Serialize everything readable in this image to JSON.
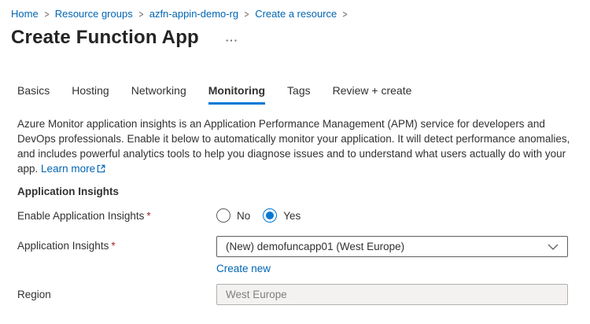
{
  "breadcrumb": {
    "separator": ">",
    "items": [
      "Home",
      "Resource groups",
      "azfn-appin-demo-rg",
      "Create a resource"
    ]
  },
  "header": {
    "title": "Create Function App",
    "more_options": "···"
  },
  "tabs": [
    {
      "label": "Basics",
      "active": false
    },
    {
      "label": "Hosting",
      "active": false
    },
    {
      "label": "Networking",
      "active": false
    },
    {
      "label": "Monitoring",
      "active": true
    },
    {
      "label": "Tags",
      "active": false
    },
    {
      "label": "Review + create",
      "active": false
    }
  ],
  "description": {
    "text": "Azure Monitor application insights is an Application Performance Management (APM) service for developers and DevOps professionals. Enable it below to automatically monitor your application. It will detect performance anomalies, and includes powerful analytics tools to help you diagnose issues and to understand what users actually do with your app.",
    "learn_more_label": "Learn more"
  },
  "section": {
    "heading": "Application Insights"
  },
  "form": {
    "enable_label": "Enable Application Insights",
    "required_marker": "*",
    "options": {
      "no": "No",
      "yes": "Yes"
    },
    "selected_option": "Yes",
    "app_insights_label": "Application Insights",
    "app_insights_value": "(New) demofuncapp01 (West Europe)",
    "create_new_label": "Create new",
    "region_label": "Region",
    "region_value": "West Europe"
  },
  "colors": {
    "link_blue": "#0065b3",
    "accent_blue": "#0078d4",
    "text": "#323130",
    "muted": "#605e5c",
    "required_red": "#a4262c",
    "disabled_bg": "#f3f2f1"
  }
}
